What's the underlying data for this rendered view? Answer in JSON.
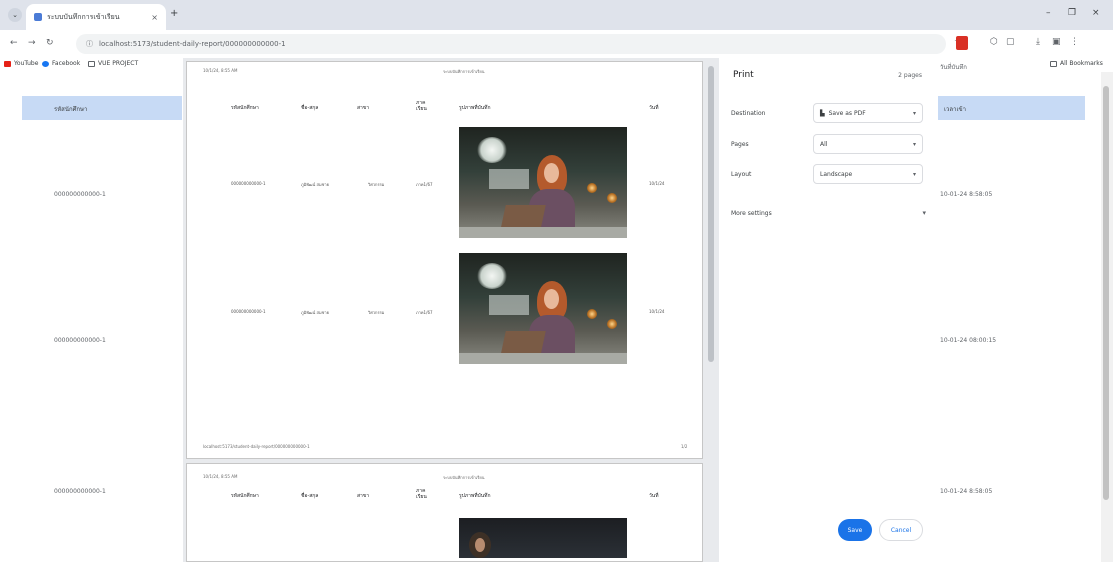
{
  "browser": {
    "tab_title": "ระบบบันทึกการเข้าเรียน",
    "tab_close": "×",
    "new_tab": "+",
    "url": "localhost:5173/student-daily-report/000000000000-1",
    "window_controls": [
      "–",
      "❐",
      "×"
    ],
    "bookmarks": [
      "YouTube",
      "Facebook",
      "VUE PROJECT"
    ],
    "bookmarks_right": [
      "All Bookmarks"
    ]
  },
  "page_background": {
    "left_header": "รหัสนักศึกษา",
    "right_header": "เวลาเข้า",
    "right_header_cut": "วันที่บันทึก",
    "rows": [
      {
        "id": "000000000000-1",
        "time": "10-01-24 8:58:05"
      },
      {
        "id": "000000000000-1",
        "time": "10-01-24 08:00:15"
      },
      {
        "id": "000000000000-1",
        "time": "10-01-24 8:58:05"
      }
    ]
  },
  "print_preview": {
    "sheet_header_left": "10/1/24, 8:55 AM",
    "sheet_header_center": "ระบบบันทึกการเข้าเรียน",
    "sheet_footer_left": "localhost:5173/student-daily-report/000000000000-1",
    "sheet_footer_right": "1/2",
    "columns": [
      "รหัสนักศึกษา",
      "ชื่อ-สกุล",
      "สาขา",
      "ภาค เรียน",
      "รูปภาพที่บันทึก",
      "วันที่"
    ],
    "rows": [
      {
        "id": "000000000000-1",
        "name": "ภูมิพัฒน์ สมชาย",
        "major": "วิศวกรรม",
        "term": "ภาค1/67",
        "date": "10/1/24"
      },
      {
        "id": "000000000000-1",
        "name": "ภูมิพัฒน์ สมชาย",
        "major": "วิศวกรรม",
        "term": "ภาค1/67",
        "date": "10/1/24"
      }
    ],
    "sheet2_header_left": "10/1/24, 8:55 AM",
    "sheet2_header_center": "ระบบบันทึกการเข้าเรียน"
  },
  "print_dialog": {
    "title": "Print",
    "pages": "2 pages",
    "destination_label": "Destination",
    "destination_value": "Save as PDF",
    "pages_label": "Pages",
    "pages_value": "All",
    "layout_label": "Layout",
    "layout_value": "Landscape",
    "more_settings": "More settings",
    "save": "Save",
    "cancel": "Cancel"
  }
}
